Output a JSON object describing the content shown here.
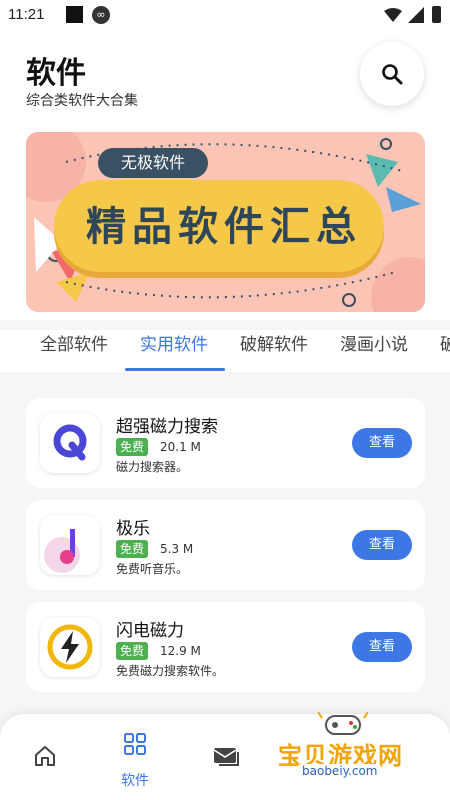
{
  "status_bar": {
    "time": "11:21"
  },
  "header": {
    "title": "软件",
    "subtitle": "综合类软件大合集",
    "search_icon": "search-icon"
  },
  "banner": {
    "tag": "无极软件",
    "headline": "精品软件汇总"
  },
  "tabs": [
    {
      "label": "全部软件",
      "active": false
    },
    {
      "label": "实用软件",
      "active": true
    },
    {
      "label": "破解软件",
      "active": false
    },
    {
      "label": "漫画小说",
      "active": false
    },
    {
      "label": "破",
      "active": false
    }
  ],
  "apps": [
    {
      "name": "超强磁力搜索",
      "badge": "免费",
      "size": "20.1 M",
      "description": "磁力搜索器。",
      "button": "查看",
      "icon": "q-magnet-icon"
    },
    {
      "name": "极乐",
      "badge": "免费",
      "size": "5.3 M",
      "description": "免费听音乐。",
      "button": "查看",
      "icon": "music-note-icon"
    },
    {
      "name": "闪电磁力",
      "badge": "免费",
      "size": "12.9 M",
      "description": "免费磁力搜索软件。",
      "button": "查看",
      "icon": "lightning-icon"
    }
  ],
  "bottom_nav": {
    "active_label": "软件"
  },
  "watermark": {
    "text": "宝贝游戏网",
    "url": "baobeiy.com"
  },
  "colors": {
    "accent": "#3d77e5",
    "badge": "#4caf50",
    "banner_bg": "#fbc4b5",
    "banner_plate": "#f5c84a"
  }
}
